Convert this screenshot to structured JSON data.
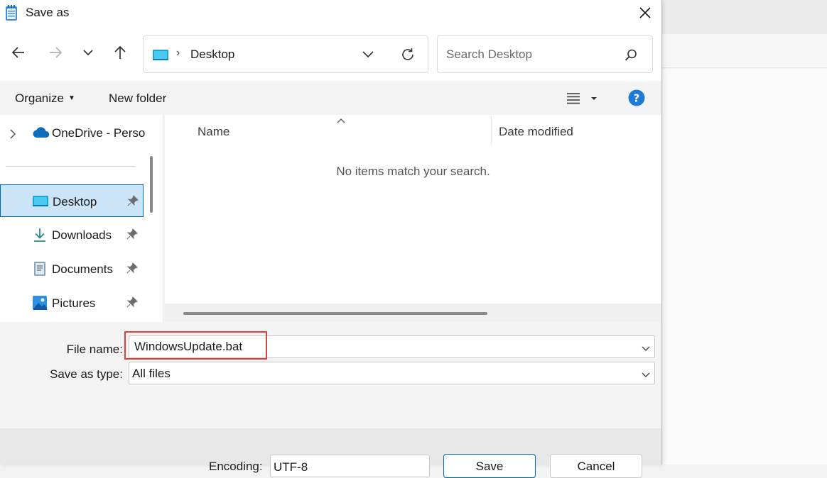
{
  "window": {
    "title": "Save as"
  },
  "address_bar": {
    "folder": "Desktop",
    "separator": "›"
  },
  "search": {
    "placeholder": "Search Desktop"
  },
  "commands": {
    "organize": "Organize",
    "new_folder": "New folder"
  },
  "nav_pane": {
    "onedrive": "OneDrive - Perso",
    "items": [
      {
        "label": "Desktop",
        "icon": "desktop-icon",
        "selected": true
      },
      {
        "label": "Downloads",
        "icon": "download-icon"
      },
      {
        "label": "Documents",
        "icon": "documents-icon"
      },
      {
        "label": "Pictures",
        "icon": "pictures-icon"
      }
    ]
  },
  "file_list": {
    "columns": [
      "Name",
      "Date modified"
    ],
    "empty_message": "No items match your search."
  },
  "form": {
    "file_name_label": "File name:",
    "file_name_value": "WindowsUpdate.bat",
    "save_type_label": "Save as type:",
    "save_type_value": "All files"
  },
  "footer": {
    "encoding_label": "Encoding:",
    "encoding_value": "UTF-8",
    "save_label": "Save",
    "cancel_label": "Cancel"
  },
  "colors": {
    "accent": "#0067c0",
    "highlight": "#e0403a",
    "selection": "#cce4f7"
  }
}
